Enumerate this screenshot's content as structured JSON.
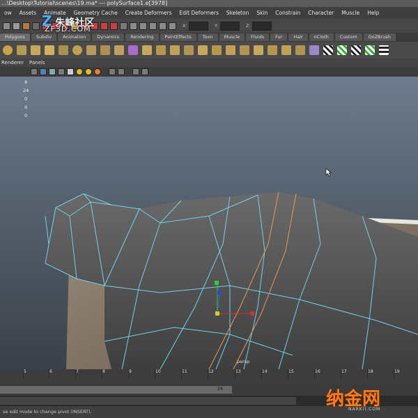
{
  "titlebar": {
    "text": "...\\Desktop\\Tutorial\\scenes\\19.ma* --- polySurface1.e[3978]"
  },
  "menubar": {
    "items": [
      "ow",
      "Assets",
      "Animate",
      "Geometry Cache",
      "Create Deformers",
      "Edit Deformers",
      "Skeleton",
      "Skin",
      "Constrain",
      "Character",
      "Muscle",
      "Help"
    ]
  },
  "toolbar": {
    "coord_labels": [
      "X:",
      "Y:",
      "Z:"
    ],
    "coord_values": [
      "",
      "",
      ""
    ]
  },
  "shelf": {
    "tabs": [
      "Polygons",
      "Subdiv",
      "Animation",
      "Dynamics",
      "Rendering",
      "PaintEffects",
      "Toon",
      "Muscle",
      "Fluids",
      "Fur",
      "Hair",
      "nCloth",
      "Custom",
      "GoZBrush"
    ],
    "active_tab": "Polygons"
  },
  "panel_menu": {
    "items": [
      "Renderer",
      "Panels"
    ]
  },
  "viewport": {
    "hud_numbers": [
      "8",
      "24",
      "0",
      "0",
      "0"
    ],
    "camera_label": "persp",
    "colors": {
      "wire": "#6fd3ec",
      "selected_edge": "#e79a55",
      "mesh": "#5a5a5a",
      "ground": "#8a7c6c"
    }
  },
  "timeline": {
    "ticks": [
      "5",
      "6",
      "7",
      "8",
      "9",
      "10",
      "11",
      "12",
      "13",
      "14",
      "15",
      "16",
      "17",
      "18",
      "19"
    ],
    "range_end": "24"
  },
  "helpline": {
    "text": "se edit mode to change pivot (INSERT)."
  },
  "watermarks": {
    "top_cn": "朱峰社区",
    "top_en": "ZF3D.COM",
    "bottom_cn": "纳金网",
    "bottom_en": "NARKII.COM"
  }
}
